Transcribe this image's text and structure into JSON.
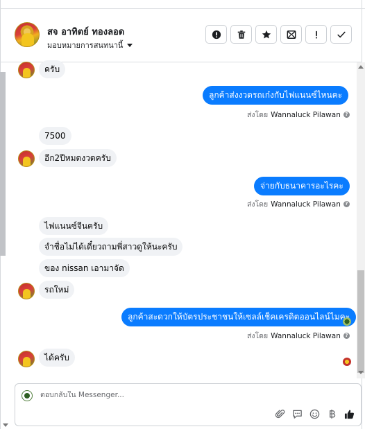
{
  "header": {
    "contact_name": "สจ อาทิตย์ ทองลอด",
    "assign_label": "มอบหมายการสนทนานี้",
    "actions": [
      {
        "name": "report-button",
        "icon": "alert-circle-icon"
      },
      {
        "name": "delete-button",
        "icon": "trash-icon"
      },
      {
        "name": "star-button",
        "icon": "star-icon"
      },
      {
        "name": "archive-button",
        "icon": "archive-icon"
      },
      {
        "name": "important-button",
        "icon": "exclamation-icon"
      },
      {
        "name": "done-button",
        "icon": "checkmark-icon"
      }
    ]
  },
  "messages": {
    "m1": "ครับ",
    "m2": "ลูกค้าส่งงวดรถเก๋งกับไฟแนนซ์ไหนคะ",
    "m3": "7500",
    "m4": "อีก2ปีหมดงวดครับ",
    "m5": "จ่ายกับธนาคารอะไรคะ",
    "m6": "ไฟแนนซ์จีนครับ",
    "m7": "จำชื่อไม่ได้เดี๋ยวถามพี่สาวดูให้นะครับ",
    "m8": "ของ nissan เอามาจัด",
    "m9": "รถใหม่",
    "m10": "ลูกค้าสะดวกให้บัตรประชาชนให้เซลล์เช็คเครดิตออนไลน์ไมคะ",
    "m11": "ได้ครับ"
  },
  "sent_by": {
    "prefix": "ส่งโดย",
    "agent": "Wannaluck Pilawan",
    "help_glyph": "?"
  },
  "composer": {
    "placeholder": "ตอบกลับใน Messenger..."
  },
  "colors": {
    "outgoing_bubble": "#0a7cff",
    "incoming_bubble": "#f0f2f5"
  }
}
